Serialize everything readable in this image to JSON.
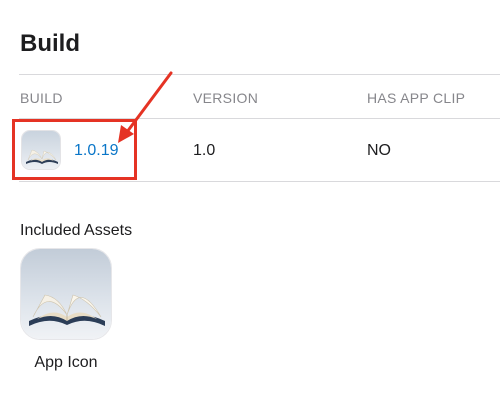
{
  "section": {
    "title": "Build"
  },
  "table": {
    "headers": {
      "build": "BUILD",
      "version": "VERSION",
      "app_clip": "HAS APP CLIP"
    },
    "row": {
      "build": "1.0.19",
      "version": "1.0",
      "app_clip": "NO",
      "thumbnail_icon": "open-book-icon"
    }
  },
  "annotation": {
    "color": "#e53324",
    "shapes": [
      "highlight-box",
      "arrow"
    ]
  },
  "assets": {
    "title": "Included Assets",
    "items": [
      {
        "label": "App Icon",
        "icon": "open-book-icon"
      }
    ]
  },
  "colors": {
    "link": "#0a76c8",
    "header_text": "#86868b",
    "divider": "#d9d9dc",
    "annotation": "#e53324"
  }
}
